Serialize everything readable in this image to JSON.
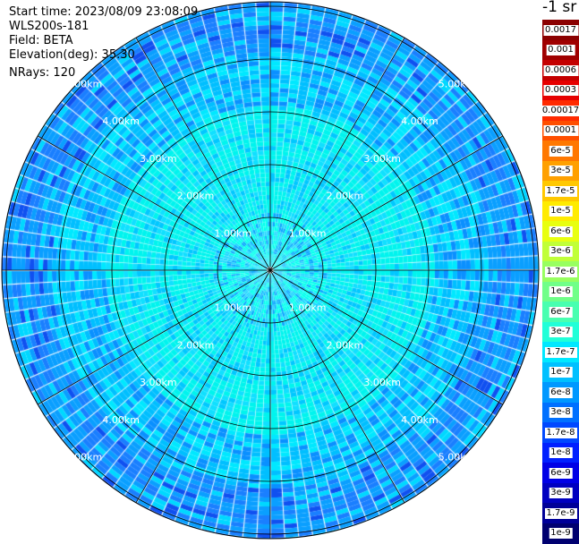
{
  "info": {
    "start_time": "Start time: 2023/08/09 23:08:09",
    "instrument": "WLS200s-181",
    "field": "Field: BETA",
    "elevation": "Elevation(deg): 35.30",
    "nrays": "NRays: 120"
  },
  "colorbar": {
    "unit": "-1 sr",
    "labels": [
      "0.0017",
      "0.001",
      "0.0006",
      "0.0003",
      "0.00017",
      "0.0001",
      "6e-5",
      "3e-5",
      "1.7e-5",
      "1e-5",
      "6e-6",
      "3e-6",
      "1.7e-6",
      "1e-6",
      "6e-7",
      "3e-7",
      "1.7e-7",
      "1e-7",
      "6e-8",
      "3e-8",
      "1.7e-8",
      "1e-8",
      "6e-9",
      "3e-9",
      "1.7e-9",
      "1e-9"
    ],
    "colors": [
      "#8b0000",
      "#a00000",
      "#c40000",
      "#e60000",
      "#ff2a00",
      "#ff4e00",
      "#ff7800",
      "#ffa000",
      "#ffc800",
      "#ffeb00",
      "#e8ff10",
      "#c0ff38",
      "#98ff60",
      "#70ff88",
      "#48ffb0",
      "#20ffd8",
      "#00e8ff",
      "#00c0ff",
      "#0098ff",
      "#0070ff",
      "#0048ff",
      "#0020ff",
      "#0000e6",
      "#0000c0",
      "#000098",
      "#000070"
    ]
  },
  "ring_labels": [
    "1.00km",
    "2.00km",
    "3.00km",
    "4.00km",
    "5.00km"
  ]
}
